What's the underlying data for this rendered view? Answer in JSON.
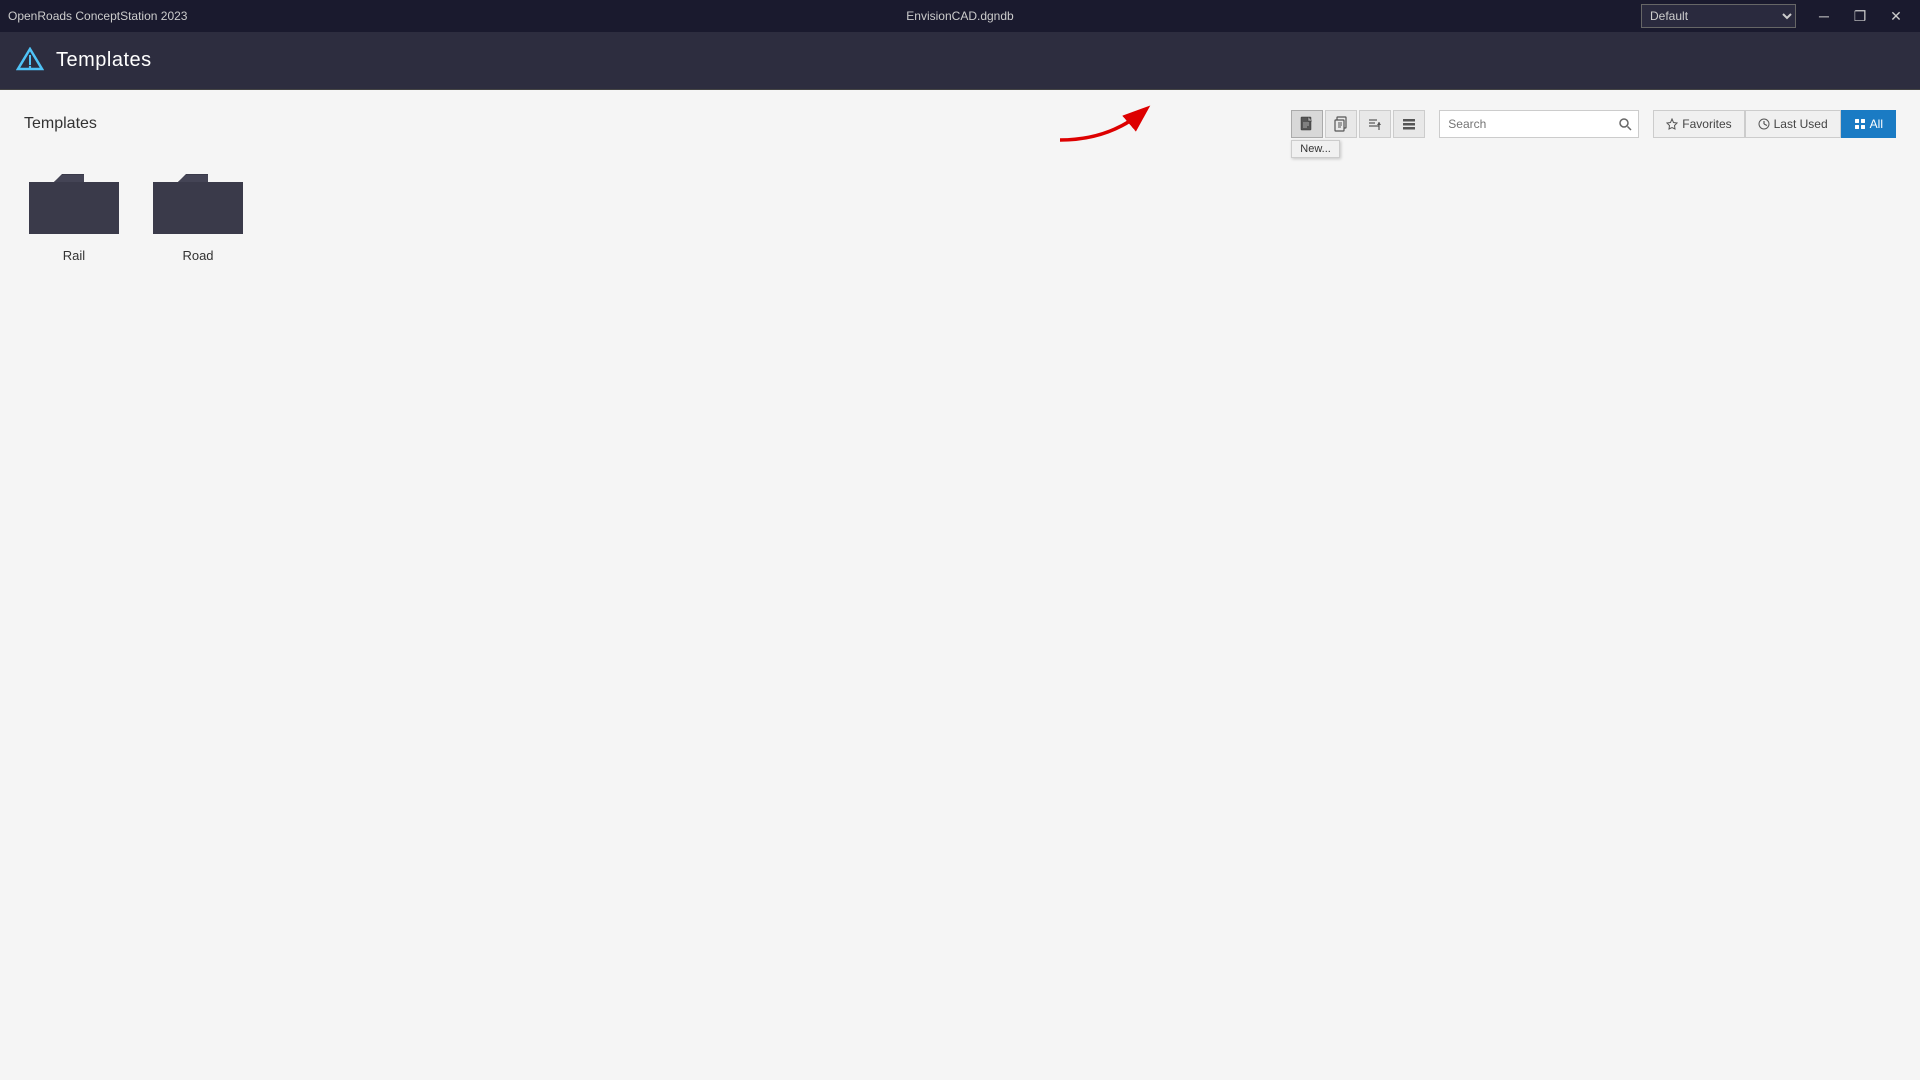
{
  "titlebar": {
    "app_name": "OpenRoads ConceptStation 2023",
    "file_name": "EnvisionCAD.dgndb",
    "workspace": "Default",
    "minimize_label": "─",
    "restore_label": "❐",
    "close_label": "✕"
  },
  "header": {
    "title": "Templates",
    "logo_alt": "OpenRoads Logo"
  },
  "content": {
    "section_title": "Templates"
  },
  "toolbar": {
    "new_label": "New...",
    "new_icon": "📄",
    "copy_icon": "⧉",
    "sort_icon": "⇅",
    "list_icon": "☰",
    "search_placeholder": "Search"
  },
  "filters": {
    "favorites_label": "Favorites",
    "last_used_label": "Last Used",
    "all_label": "All",
    "active": "all"
  },
  "folders": [
    {
      "name": "Rail",
      "id": "rail"
    },
    {
      "name": "Road",
      "id": "road"
    }
  ]
}
